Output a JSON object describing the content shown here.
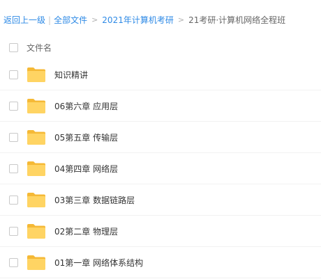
{
  "breadcrumb": {
    "back": "返回上一级",
    "all_files": "全部文件",
    "folder": "2021年计算机考研",
    "current": "21考研·计算机网络全程班"
  },
  "header": {
    "column_name": "文件名"
  },
  "colors": {
    "link": "#2e8ae6",
    "folder": "#ffd463",
    "folder_tab": "#f5b936"
  },
  "files": [
    {
      "name": "知识精讲",
      "icon": "folder-icon"
    },
    {
      "name": "06第六章 应用层",
      "icon": "folder-icon"
    },
    {
      "name": "05第五章 传输层",
      "icon": "folder-icon"
    },
    {
      "name": "04第四章 网络层",
      "icon": "folder-icon"
    },
    {
      "name": "03第三章 数据链路层",
      "icon": "folder-icon"
    },
    {
      "name": "02第二章 物理层",
      "icon": "folder-icon"
    },
    {
      "name": "01第一章 网络体系结构",
      "icon": "folder-icon"
    }
  ]
}
